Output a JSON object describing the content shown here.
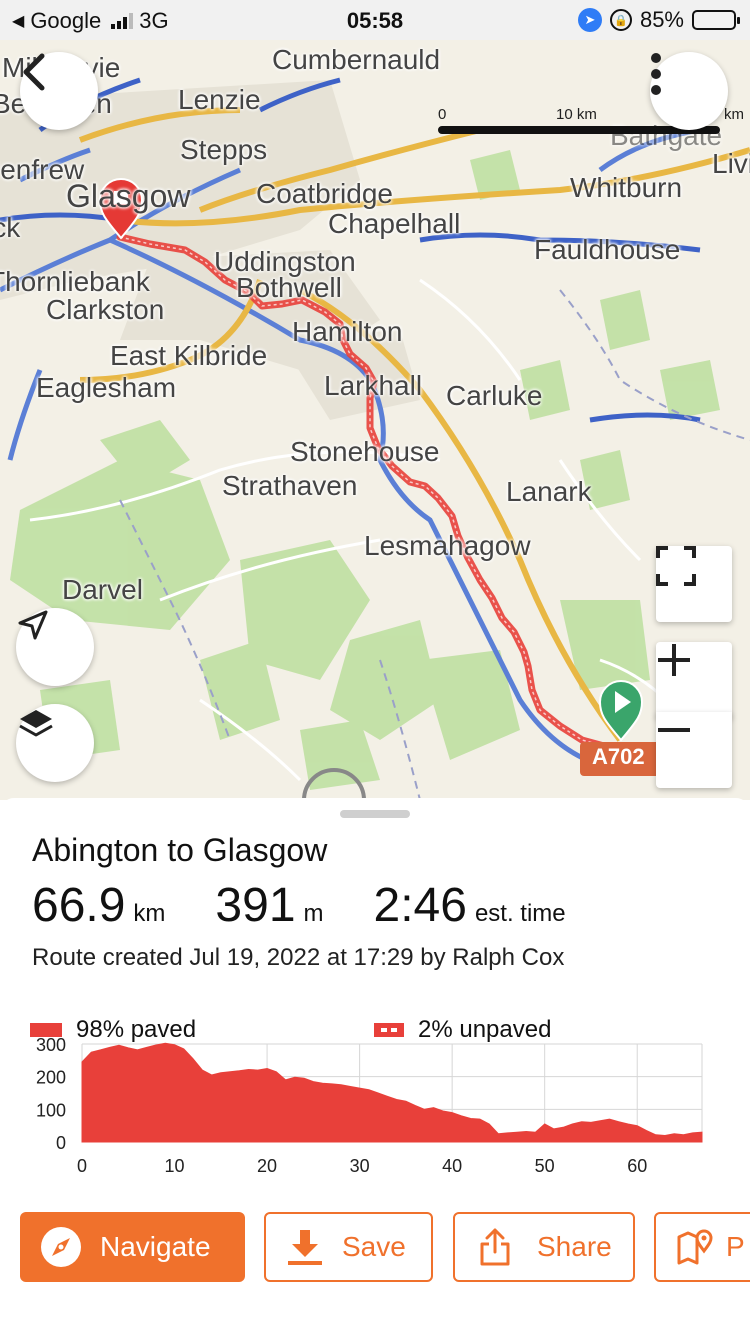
{
  "status_bar": {
    "back_app": "Google",
    "network": "3G",
    "time": "05:58",
    "battery": "85%",
    "battery_level": 0.85
  },
  "map": {
    "scale": {
      "start": "0",
      "mid": "10 km",
      "end": "km"
    },
    "places": [
      "Milngavie",
      "Bearsden",
      "Lenzie",
      "Cumbernauld",
      "Stepps",
      "Renfrew",
      "Glasgow",
      "Coatbridge",
      "Chapelhall",
      "Whitburn",
      "Bathgate",
      "Livingston",
      "Fauldhouse",
      "Giffnock",
      "Thornliebank",
      "Clarkston",
      "Uddingston",
      "Bothwell",
      "Hamilton",
      "East Kilbride",
      "Eaglesham",
      "Larkhall",
      "Carluke",
      "Stonehouse",
      "Strathaven",
      "Lanark",
      "Lesmahagow",
      "Darvel",
      "A702"
    ],
    "accent": "#e8403a",
    "start_marker_color": "#3aa56b",
    "end_marker_color": "#e53935"
  },
  "route": {
    "title": "Abington to Glasgow",
    "distance": "66.9",
    "distance_unit": "km",
    "elevation": "391",
    "elevation_unit": "m",
    "duration": "2:46",
    "duration_label": "est. time",
    "created": "Route created Jul 19, 2022 at 17:29 by Ralph Cox"
  },
  "surface_legend": {
    "paved": "98% paved",
    "unpaved": "2% unpaved"
  },
  "chart_data": {
    "type": "area",
    "title": "",
    "xlabel": "",
    "ylabel": "",
    "xlim": [
      0,
      67
    ],
    "ylim": [
      0,
      300
    ],
    "x_ticks": [
      "0",
      "10",
      "20",
      "30",
      "40",
      "50",
      "60"
    ],
    "y_ticks": [
      "0",
      "100",
      "200",
      "300"
    ],
    "grid": true,
    "color": "#e8403a",
    "series": [
      {
        "x": [
          0,
          1,
          2,
          3,
          4,
          5,
          6,
          7,
          8,
          9,
          10,
          11,
          12,
          13,
          14,
          15,
          16,
          17,
          18,
          19,
          20,
          21,
          22,
          23,
          24,
          25,
          26,
          27,
          28,
          29,
          30,
          31,
          32,
          33,
          34,
          35,
          36,
          37,
          38,
          39,
          40,
          41,
          42,
          43,
          44,
          45,
          46,
          47,
          48,
          49,
          50,
          51,
          52,
          53,
          54,
          55,
          56,
          57,
          58,
          59,
          60,
          61,
          62,
          63,
          64,
          65,
          66,
          67
        ],
        "y": [
          245,
          275,
          282,
          290,
          296,
          288,
          282,
          290,
          297,
          302,
          298,
          285,
          255,
          220,
          205,
          212,
          215,
          218,
          222,
          220,
          225,
          215,
          190,
          198,
          195,
          185,
          180,
          178,
          175,
          170,
          165,
          160,
          150,
          140,
          130,
          125,
          112,
          100,
          105,
          95,
          90,
          80,
          72,
          70,
          55,
          25,
          28,
          30,
          32,
          30,
          55,
          40,
          45,
          55,
          62,
          60,
          65,
          70,
          62,
          55,
          50,
          35,
          22,
          20,
          25,
          22,
          28,
          30
        ]
      }
    ]
  },
  "actions": {
    "navigate": "Navigate",
    "save": "Save",
    "share": "Share",
    "plan": "P"
  }
}
